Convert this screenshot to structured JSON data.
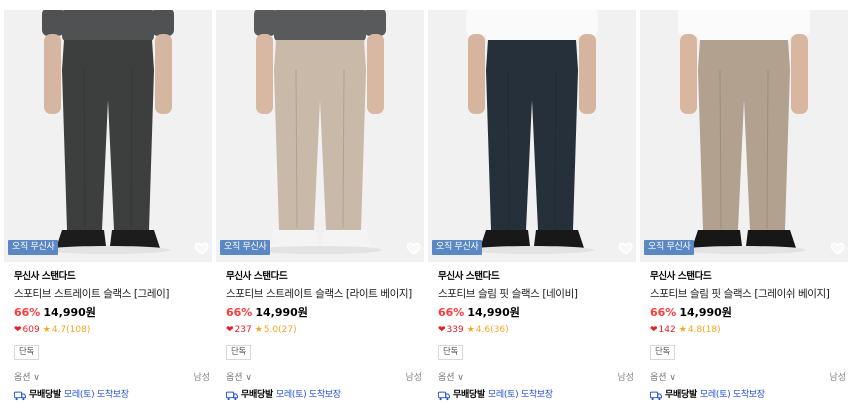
{
  "products": [
    {
      "brand": "무신사 스탠다드",
      "name": "스포티브 스트레이트 슬랙스 [그레이]",
      "discount": "66%",
      "price": "14,990원",
      "likes": "609",
      "rating": "4.7(108)",
      "badge": "오직 무신사",
      "exclusive": "단독",
      "option": "옵션 ∨",
      "gender": "남성",
      "ship_free": "무배당발",
      "ship_arrival": "모레(토) 도착보장",
      "colors": {
        "pants": "#3d3f3e",
        "shirt": "#505152",
        "shoe": "#1c1c1c",
        "skin": "#d5b6a0"
      }
    },
    {
      "brand": "무신사 스탠다드",
      "name": "스포티브 스트레이트 슬랙스 [라이트 베이지]",
      "discount": "66%",
      "price": "14,990원",
      "likes": "237",
      "rating": "5.0(27)",
      "badge": "오직 무신사",
      "exclusive": "단독",
      "option": "옵션 ∨",
      "gender": "남성",
      "ship_free": "무배당발",
      "ship_arrival": "모레(토) 도착보장",
      "colors": {
        "pants": "#c8b9a8",
        "shirt": "#595a5b",
        "shoe": "#f4f4f4",
        "skin": "#d8b8a2"
      }
    },
    {
      "brand": "무신사 스탠다드",
      "name": "스포티브 슬림 핏 슬랙스 [네이비]",
      "discount": "66%",
      "price": "14,990원",
      "likes": "339",
      "rating": "4.6(36)",
      "badge": "오직 무신사",
      "exclusive": "단독",
      "option": "옵션 ∨",
      "gender": "남성",
      "ship_free": "무배당발",
      "ship_arrival": "모레(토) 도착보장",
      "colors": {
        "pants": "#26303b",
        "shirt": "#fafafa",
        "shoe": "#181818",
        "skin": "#d6b59e"
      }
    },
    {
      "brand": "무신사 스탠다드",
      "name": "스포티브 슬림 핏 슬랙스 [그레이쉬 베이지]",
      "discount": "66%",
      "price": "14,990원",
      "likes": "142",
      "rating": "4.8(18)",
      "badge": "오직 무신사",
      "exclusive": "단독",
      "option": "옵션 ∨",
      "gender": "남성",
      "ship_free": "무배당발",
      "ship_arrival": "모레(토) 도착보장",
      "colors": {
        "pants": "#b3a18f",
        "shirt": "#fbfbfb",
        "shoe": "#171717",
        "skin": "#d8b6a0"
      }
    }
  ]
}
